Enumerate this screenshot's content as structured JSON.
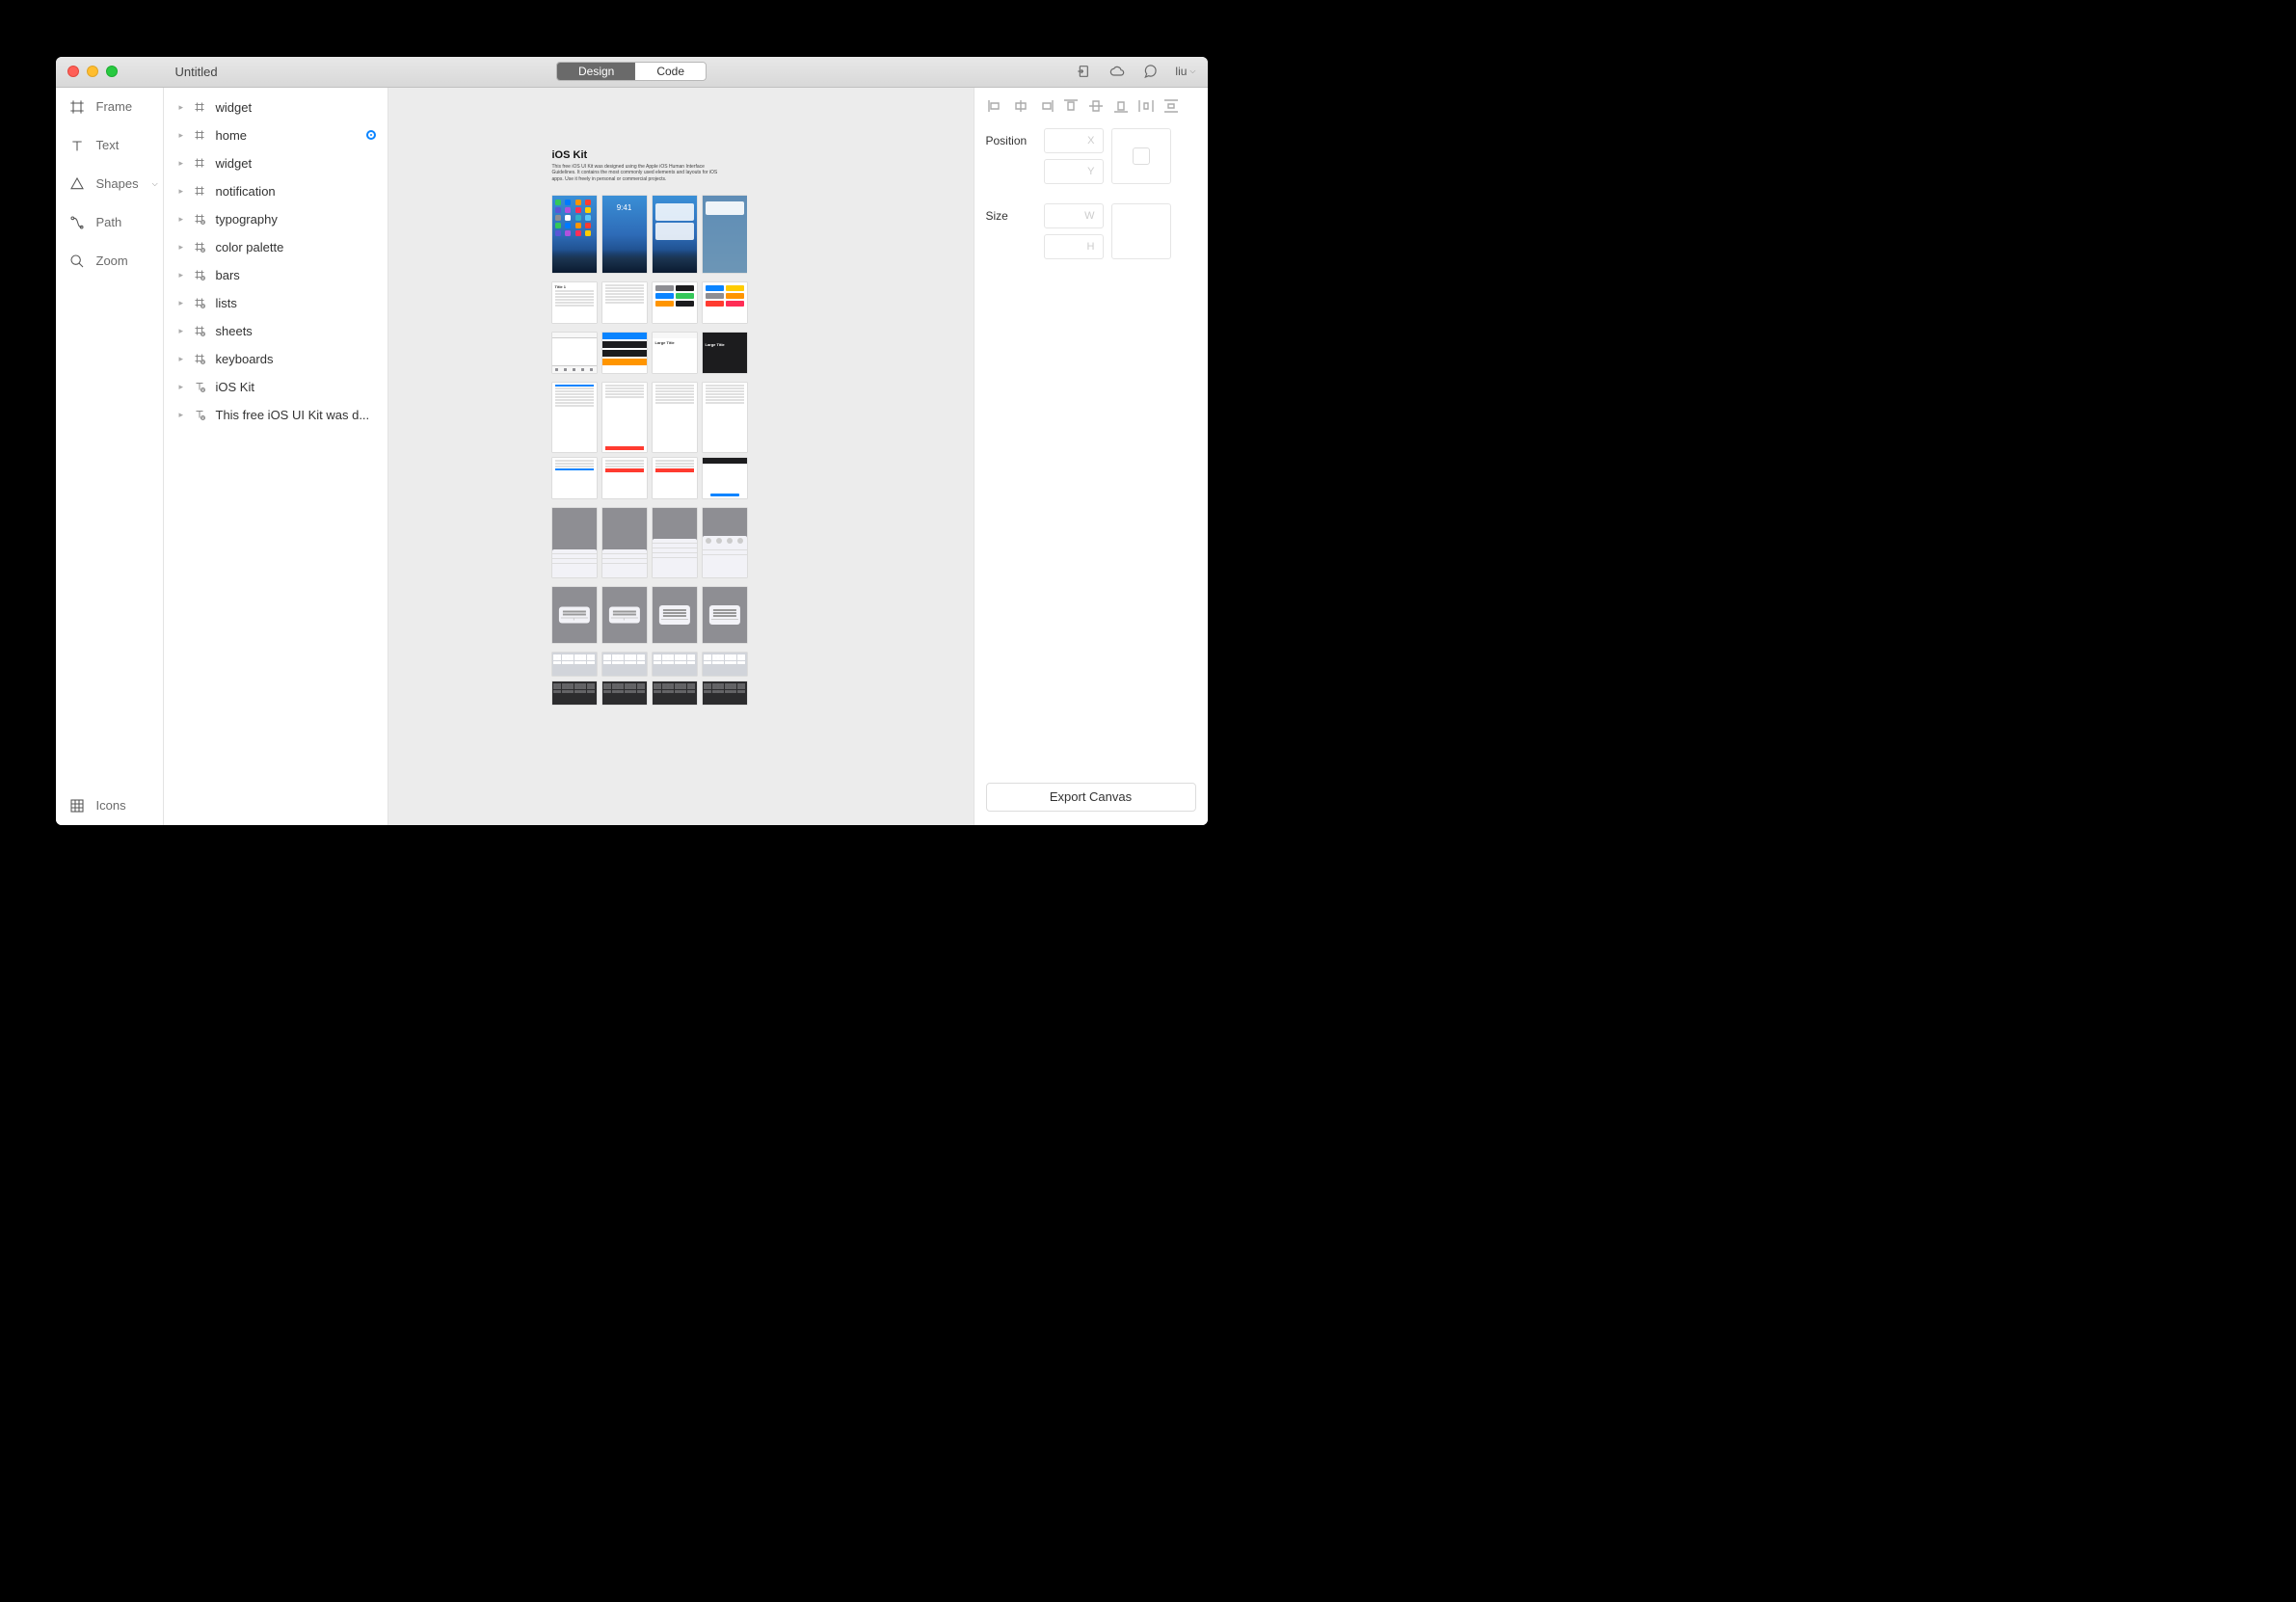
{
  "window": {
    "title": "Untitled"
  },
  "tabs": {
    "design": "Design",
    "code": "Code",
    "active": "design"
  },
  "user": "liu",
  "tools": [
    {
      "id": "frame",
      "label": "Frame"
    },
    {
      "id": "text",
      "label": "Text"
    },
    {
      "id": "shapes",
      "label": "Shapes",
      "hasDropdown": true
    },
    {
      "id": "path",
      "label": "Path"
    },
    {
      "id": "zoom",
      "label": "Zoom"
    }
  ],
  "iconsFooter": "Icons",
  "layers": [
    {
      "type": "frame",
      "label": "widget"
    },
    {
      "type": "frame",
      "label": "home",
      "selected": true
    },
    {
      "type": "frame",
      "label": "widget"
    },
    {
      "type": "frame",
      "label": "notification"
    },
    {
      "type": "frame-locked",
      "label": "typography"
    },
    {
      "type": "frame-locked",
      "label": "color palette"
    },
    {
      "type": "frame-locked",
      "label": "bars"
    },
    {
      "type": "frame-locked",
      "label": "lists"
    },
    {
      "type": "frame-locked",
      "label": "sheets"
    },
    {
      "type": "frame-locked",
      "label": "keyboards"
    },
    {
      "type": "text-locked",
      "label": "iOS Kit"
    },
    {
      "type": "text-locked",
      "label": "This free iOS UI Kit was d..."
    }
  ],
  "canvas": {
    "kitTitle": "iOS Kit",
    "kitDescription": "This free iOS UI Kit was designed using the Apple iOS Human Interface Guidelines. It contains the most commonly used elements and layouts for iOS apps. Use it freely in personal or commercial projects.",
    "lockTime": "9:41"
  },
  "inspector": {
    "positionLabel": "Position",
    "sizeLabel": "Size",
    "x": "X",
    "y": "Y",
    "w": "W",
    "h": "H",
    "exportLabel": "Export Canvas"
  },
  "appColors": [
    "#34c759",
    "#007aff",
    "#ff9500",
    "#ff3b30",
    "#5856d6",
    "#af52de",
    "#ff2d55",
    "#ffcc00",
    "#8e8e93",
    "#ffffff",
    "#30b0c7",
    "#5ac8fa"
  ],
  "colorPalette": [
    "#8e8e93",
    "#1c1c1e",
    "#0a84ff",
    "#34c759",
    "#ff9500",
    "#1c1c1e",
    "#0a84ff",
    "#ffcc00",
    "#8e8e93",
    "#ff9500",
    "#ff3b30",
    "#ff2d55"
  ]
}
